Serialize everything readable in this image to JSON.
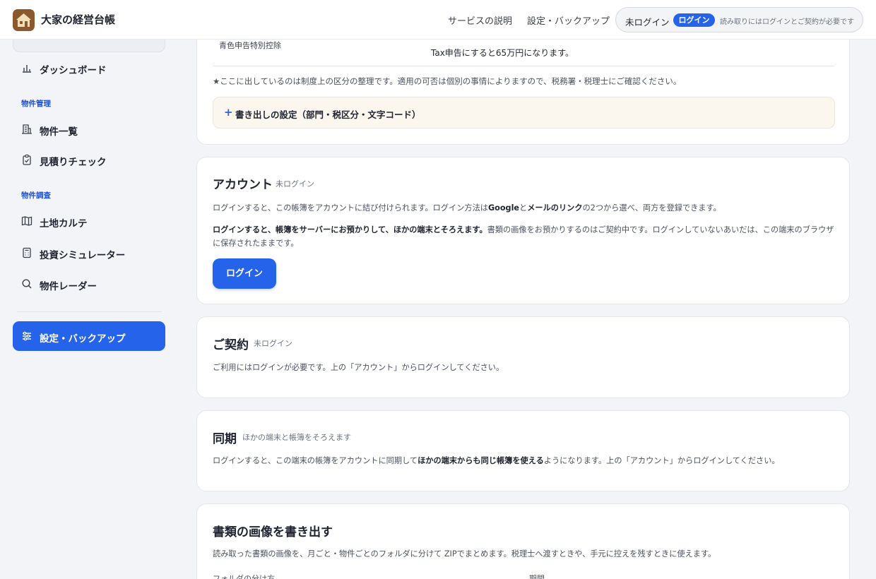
{
  "header": {
    "app_title": "大家の経営台帳",
    "nav": {
      "service": "サービスの説明",
      "settings": "設定・バックアップ"
    },
    "auth": {
      "status": "未ログイン",
      "login_label": "ログイン",
      "note": "読み取りにはログインとご契約が必要です"
    }
  },
  "sidebar": {
    "dashboard": "ダッシュボード",
    "section_property": "物件管理",
    "property_list": "物件一覧",
    "estimate_check": "見積りチェック",
    "section_research": "物件調査",
    "land_karte": "土地カルテ",
    "investment_sim": "投資シミュレーター",
    "property_radar": "物件レーダー",
    "settings_backup": "設定・バックアップ"
  },
  "tax_card": {
    "row_label": "青色申告特別控除",
    "row_value": "Tax申告にすると65万円になります。",
    "note": "★ここに出しているのは制度上の区分の整理です。適用の可否は個別の事情によりますので、税務署・税理士にご確認ください。",
    "accordion_plus": "+",
    "accordion_label": "書き出しの設定（部門・税区分・文字コード）"
  },
  "account": {
    "title": "アカウント",
    "status": "未ログイン",
    "text1_a": "ログインすると、この帳簿をアカウントに結び付けられます。ログイン方法は",
    "text1_google": "Google",
    "text1_b": "と",
    "text1_mail": "メールのリンク",
    "text1_c": "の2つから選べ、両方を登録できます。",
    "text2_bold": "ログインすると、帳簿をサーバーにお預かりして、ほかの端末とそろえます。",
    "text2_rest": "書類の画像をお預かりするのはご契約中です。ログインしていないあいだは、この端末のブラウザに保存されたままです。",
    "login_button": "ログイン"
  },
  "contract": {
    "title": "ご契約",
    "status": "未ログイン",
    "text": "ご利用にはログインが必要です。上の「アカウント」からログインしてください。"
  },
  "sync": {
    "title": "同期",
    "subtitle": "ほかの端末と帳簿をそろえます",
    "text_a": "ログインすると、この端末の帳簿をアカウントに同期して",
    "text_bold": "ほかの端末からも同じ帳簿を使える",
    "text_b": "ようになります。上の「アカウント」からログインしてください。"
  },
  "export": {
    "title": "書類の画像を書き出す",
    "text": "読み取った書類の画像を、月ごと・物件ごとのフォルダに分けて ZIPでまとめます。税理士へ渡すときや、手元に控えを残すときに使えます。",
    "folder_label": "フォルダの分け方",
    "period_label": "期間"
  },
  "colors": {
    "accent": "#2563eb",
    "section_heading": "#1d4ed8",
    "logo_bg": "#8a5a2e",
    "page_bg": "#f3f4f7"
  }
}
